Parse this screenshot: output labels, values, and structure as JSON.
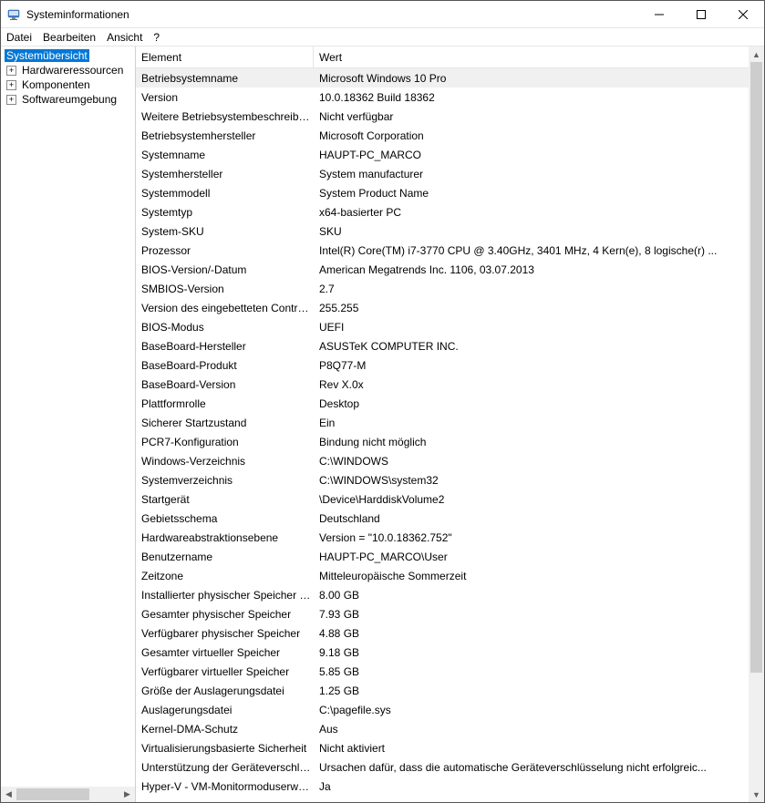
{
  "window": {
    "title": "Systeminformationen"
  },
  "menu": {
    "file": "Datei",
    "edit": "Bearbeiten",
    "view": "Ansicht",
    "help": "?"
  },
  "tree": {
    "root": "Systemübersicht",
    "items": [
      "Hardwareressourcen",
      "Komponenten",
      "Softwareumgebung"
    ]
  },
  "columns": {
    "element": "Element",
    "value": "Wert"
  },
  "rows": [
    {
      "el": "Betriebsystemname",
      "val": "Microsoft Windows 10 Pro",
      "sel": true
    },
    {
      "el": "Version",
      "val": "10.0.18362 Build 18362"
    },
    {
      "el": "Weitere Betriebsystembeschreibung",
      "val": "Nicht verfügbar"
    },
    {
      "el": "Betriebsystemhersteller",
      "val": "Microsoft Corporation"
    },
    {
      "el": "Systemname",
      "val": "HAUPT-PC_MARCO"
    },
    {
      "el": "Systemhersteller",
      "val": "System manufacturer"
    },
    {
      "el": "Systemmodell",
      "val": "System Product Name"
    },
    {
      "el": "Systemtyp",
      "val": "x64-basierter PC"
    },
    {
      "el": "System-SKU",
      "val": "SKU"
    },
    {
      "el": "Prozessor",
      "val": "Intel(R) Core(TM) i7-3770 CPU @ 3.40GHz, 3401 MHz, 4 Kern(e), 8 logische(r) ..."
    },
    {
      "el": "BIOS-Version/-Datum",
      "val": "American Megatrends Inc. 1106, 03.07.2013"
    },
    {
      "el": "SMBIOS-Version",
      "val": "2.7"
    },
    {
      "el": "Version des eingebetteten Controllers",
      "val": "255.255"
    },
    {
      "el": "BIOS-Modus",
      "val": "UEFI"
    },
    {
      "el": "BaseBoard-Hersteller",
      "val": "ASUSTeK COMPUTER INC."
    },
    {
      "el": "BaseBoard-Produkt",
      "val": "P8Q77-M"
    },
    {
      "el": "BaseBoard-Version",
      "val": "Rev X.0x"
    },
    {
      "el": "Plattformrolle",
      "val": "Desktop"
    },
    {
      "el": "Sicherer Startzustand",
      "val": "Ein"
    },
    {
      "el": "PCR7-Konfiguration",
      "val": "Bindung nicht möglich"
    },
    {
      "el": "Windows-Verzeichnis",
      "val": "C:\\WINDOWS"
    },
    {
      "el": "Systemverzeichnis",
      "val": "C:\\WINDOWS\\system32"
    },
    {
      "el": "Startgerät",
      "val": "\\Device\\HarddiskVolume2"
    },
    {
      "el": "Gebietsschema",
      "val": "Deutschland"
    },
    {
      "el": "Hardwareabstraktionsebene",
      "val": "Version = \"10.0.18362.752\""
    },
    {
      "el": "Benutzername",
      "val": "HAUPT-PC_MARCO\\User"
    },
    {
      "el": "Zeitzone",
      "val": "Mitteleuropäische Sommerzeit"
    },
    {
      "el": "Installierter physischer Speicher (RAM)",
      "val": "8.00 GB"
    },
    {
      "el": "Gesamter physischer Speicher",
      "val": "7.93 GB"
    },
    {
      "el": "Verfügbarer physischer Speicher",
      "val": "4.88 GB"
    },
    {
      "el": "Gesamter virtueller Speicher",
      "val": "9.18 GB"
    },
    {
      "el": "Verfügbarer virtueller Speicher",
      "val": "5.85 GB"
    },
    {
      "el": "Größe der Auslagerungsdatei",
      "val": "1.25 GB"
    },
    {
      "el": "Auslagerungsdatei",
      "val": "C:\\pagefile.sys"
    },
    {
      "el": "Kernel-DMA-Schutz",
      "val": "Aus"
    },
    {
      "el": "Virtualisierungsbasierte Sicherheit",
      "val": "Nicht aktiviert"
    },
    {
      "el": "Unterstützung der Geräteverschlüsselung",
      "val": "Ursachen dafür, dass die automatische Geräteverschlüsselung nicht erfolgreic..."
    },
    {
      "el": "Hyper-V - VM-Monitormoduserweiterungen",
      "val": "Ja"
    }
  ]
}
